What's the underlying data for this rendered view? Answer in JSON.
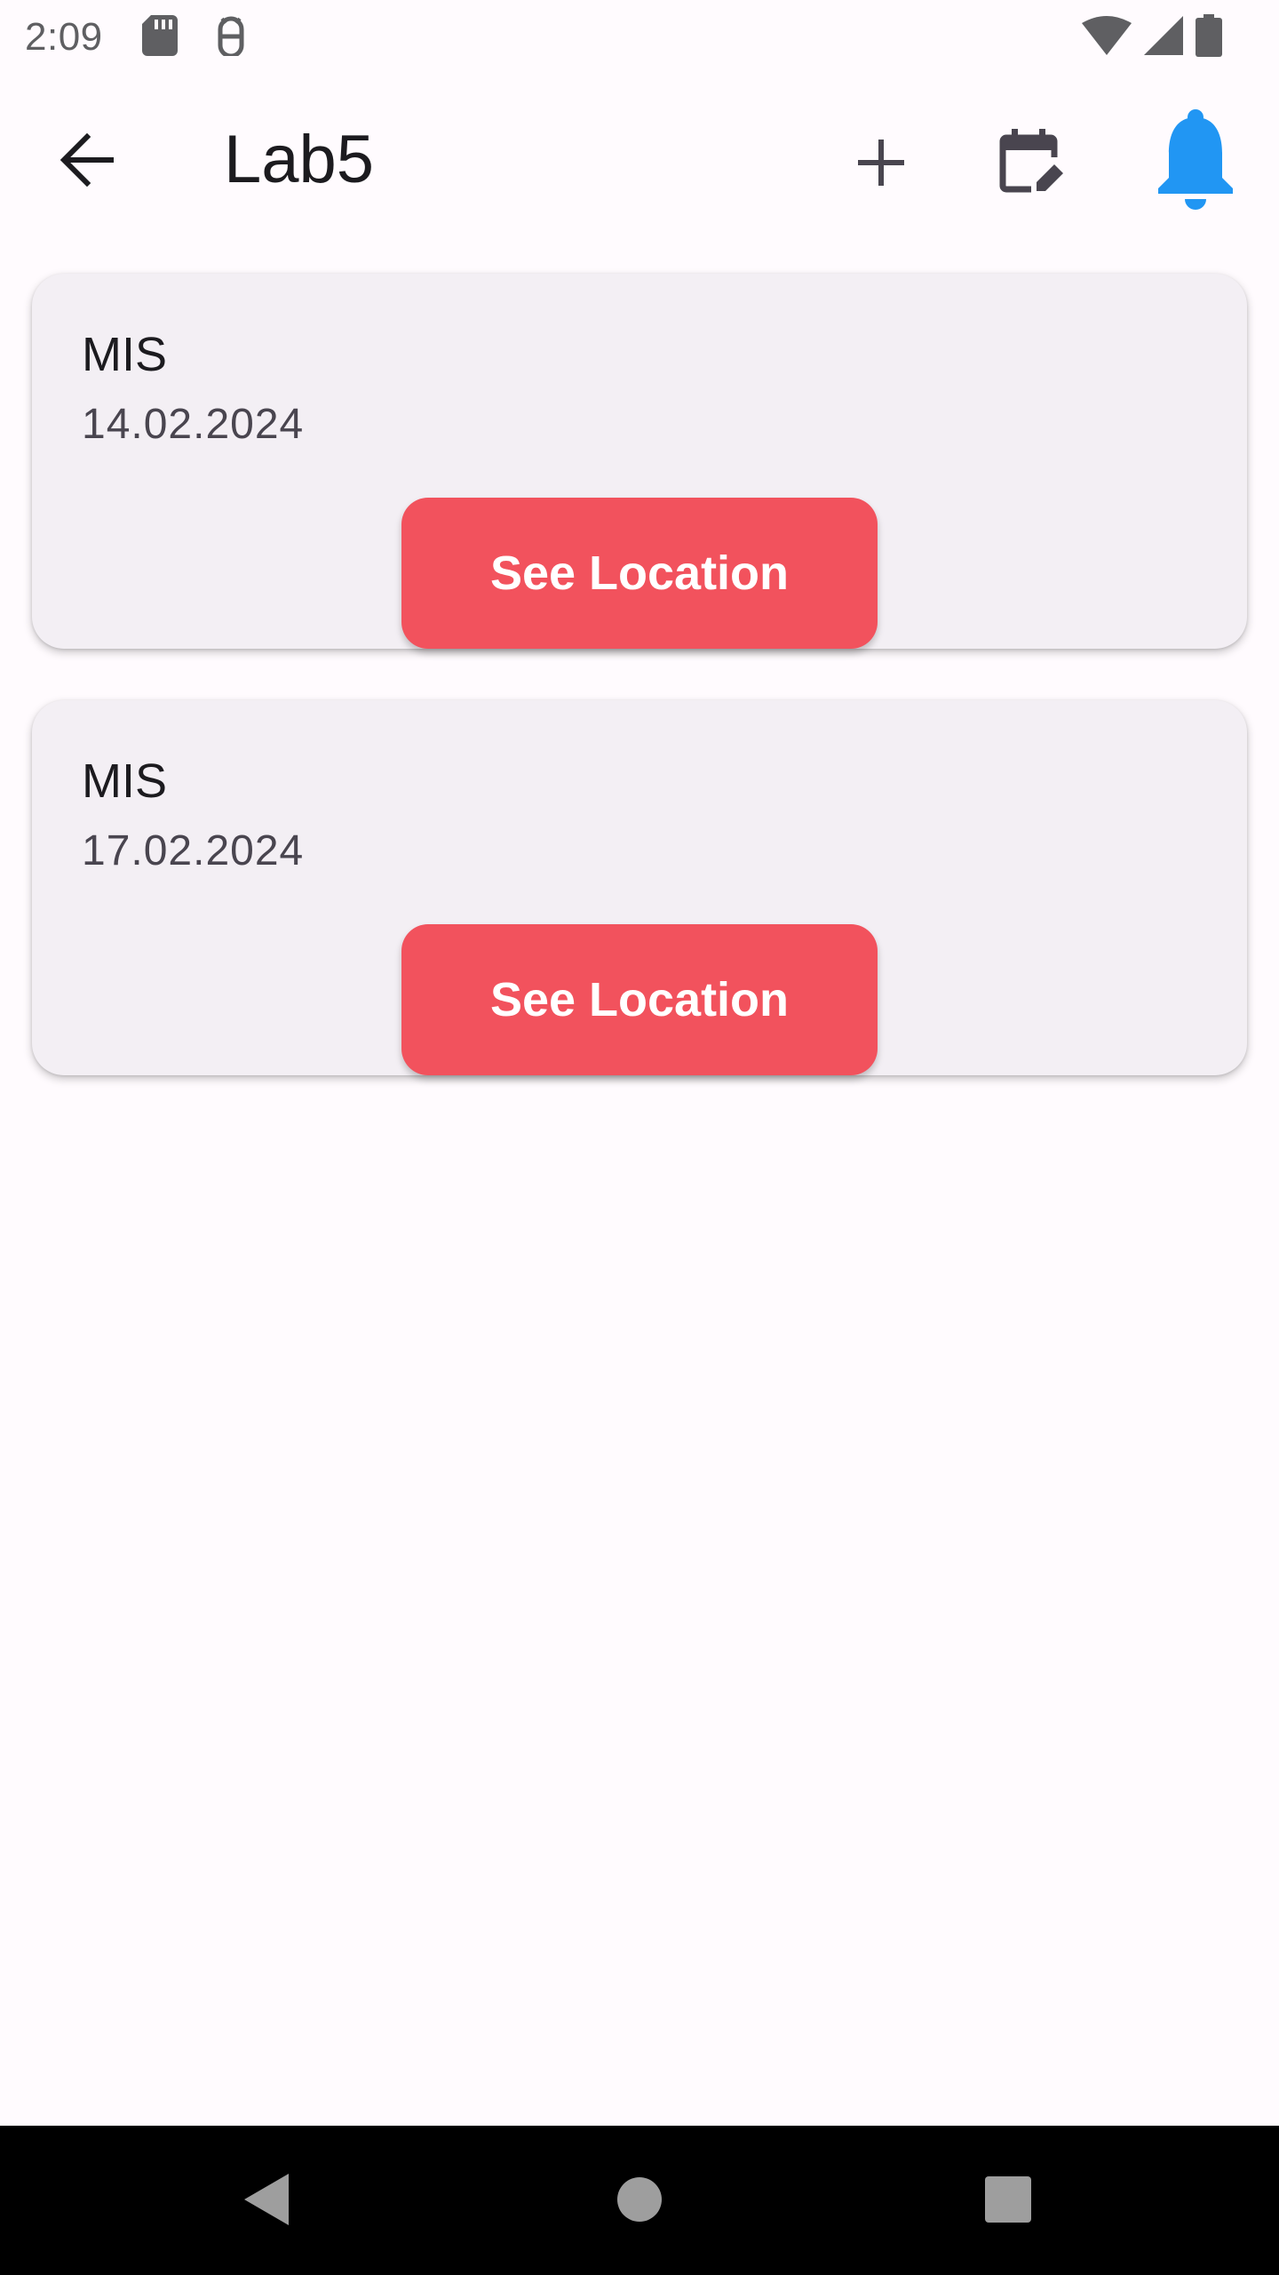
{
  "status_bar": {
    "time": "2:09",
    "left_icons": [
      "sd-card-icon",
      "android-debug-icon"
    ],
    "right_icons": [
      "wifi-icon",
      "cell-signal-icon",
      "battery-icon"
    ]
  },
  "app_bar": {
    "title": "Lab5",
    "back_icon": "arrow-back-icon",
    "actions": [
      "add-icon",
      "edit-calendar-icon",
      "notifications-bell-icon"
    ],
    "bell_color": "#2196f3"
  },
  "events": [
    {
      "title": "MIS",
      "date": "14.02.2024",
      "button_label": "See Location"
    },
    {
      "title": "MIS",
      "date": "17.02.2024",
      "button_label": "See Location"
    }
  ],
  "colors": {
    "accent": "#f2525d",
    "card_bg": "#f3eff4",
    "background": "#fffbfe"
  },
  "nav_bar": {
    "buttons": [
      "back-triangle-icon",
      "home-circle-icon",
      "recents-square-icon"
    ]
  }
}
